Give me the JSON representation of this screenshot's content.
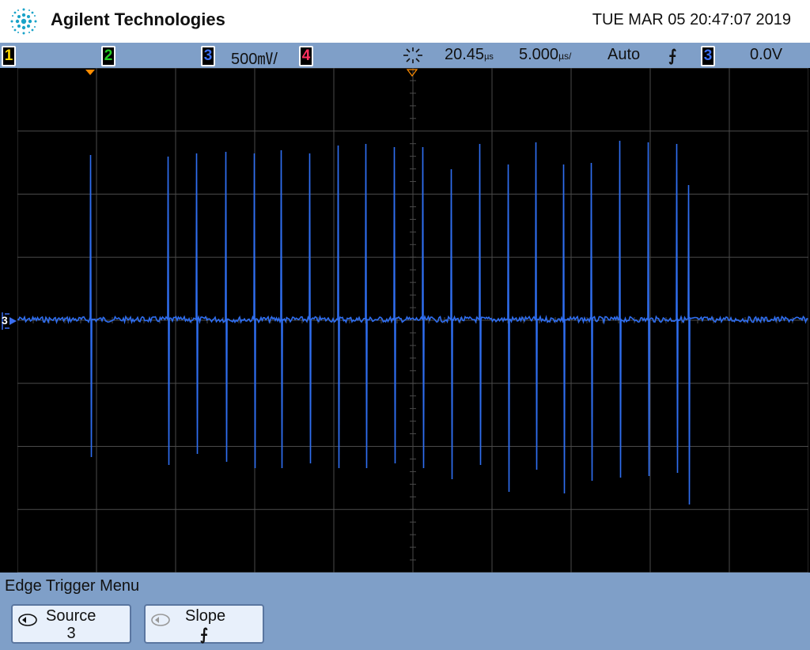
{
  "header": {
    "brand": "Agilent Technologies",
    "datetime": "TUE MAR 05 20:47:07 2019"
  },
  "status": {
    "ch1": "1",
    "ch2": "2",
    "ch3": "3",
    "ch3_scale": "500㎷/",
    "ch4": "4",
    "time_delay": "20.45",
    "time_delay_unit": "µs",
    "time_scale": "5.000",
    "time_scale_unit": "µs/",
    "trigger_mode": "Auto",
    "trigger_slope_symbol": "⨍",
    "trigger_source": "3",
    "trigger_level": "0.0V"
  },
  "display": {
    "ground_marker_label": "3",
    "trace_color": "#2f6ef0",
    "grid_color": "#4a4a4a"
  },
  "menu": {
    "title": "Edge Trigger Menu",
    "softkeys": [
      {
        "label": "Source",
        "value": "3"
      },
      {
        "label": "Slope",
        "value": "⨍"
      }
    ]
  },
  "colors": {
    "ch1": "#ffd800",
    "ch2": "#22cc22",
    "ch3": "#3a6ef0",
    "ch4": "#ff3060",
    "panel": "#7f9fc8",
    "marker": "#ff8c00"
  }
}
